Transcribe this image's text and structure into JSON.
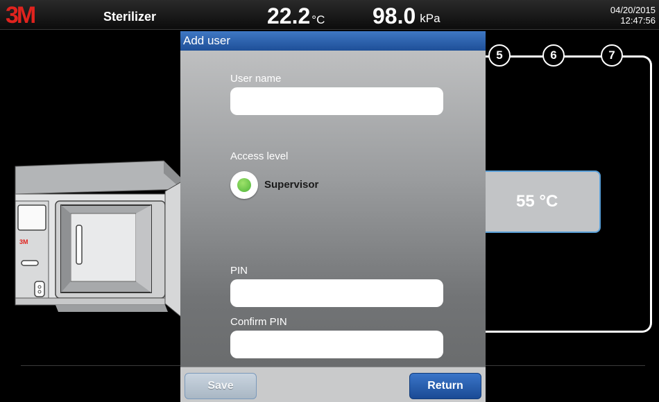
{
  "header": {
    "brand": "3M",
    "title": "Sterilizer",
    "temperature_value": "22.2",
    "temperature_unit": "°C",
    "pressure_value": "98.0",
    "pressure_unit": "kPa",
    "date": "04/20/2015",
    "time": "12:47:56"
  },
  "cycle": {
    "steps": [
      "5",
      "6",
      "7"
    ],
    "chamber_temperature": "55 °C"
  },
  "machine": {
    "brand": "3M"
  },
  "dialog": {
    "title": "Add user",
    "user_name": {
      "label": "User name",
      "value": ""
    },
    "access_level": {
      "label": "Access level",
      "selected": "Supervisor"
    },
    "pin": {
      "label": "PIN",
      "value": ""
    },
    "confirm_pin": {
      "label": "Confirm PIN",
      "value": ""
    },
    "save_label": "Save",
    "return_label": "Return"
  },
  "colors": {
    "brand_red": "#e0231e",
    "title_bar_blue": "#2a5fad",
    "radio_green": "#5cbf42",
    "return_button_blue": "#1e4f98"
  }
}
